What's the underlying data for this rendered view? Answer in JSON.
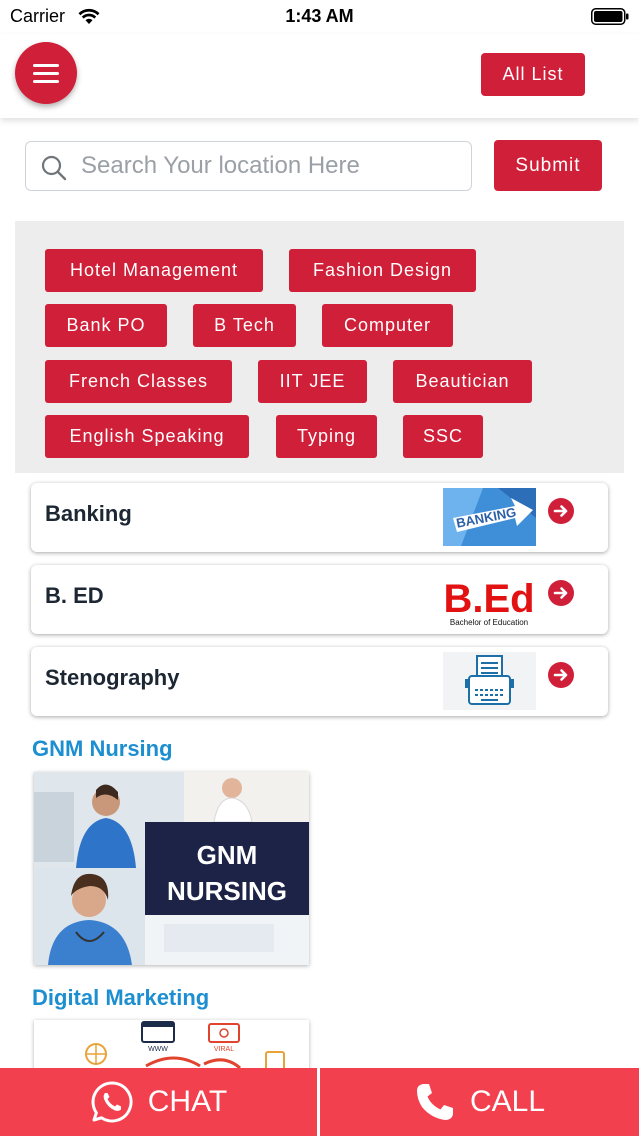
{
  "status_bar": {
    "carrier": "Carrier",
    "time": "1:43 AM"
  },
  "header": {
    "all_list_label": "All List"
  },
  "search": {
    "placeholder": "Search Your location Here",
    "value": "",
    "submit_label": "Submit"
  },
  "tags": [
    "Hotel Management",
    "Fashion Design",
    "Bank PO",
    "B Tech",
    "Computer",
    "French Classes",
    "IIT JEE",
    "Beautician",
    "English Speaking",
    "Typing",
    "SSC"
  ],
  "courses": [
    {
      "title": "Banking",
      "thumb_text": "BANKING"
    },
    {
      "title": "B. ED",
      "thumb_text": "B.Ed",
      "thumb_subtext": "Bachelor of Education"
    },
    {
      "title": "Stenography"
    }
  ],
  "sections": [
    {
      "title": "GNM Nursing",
      "image_text": [
        "GNM",
        "NURSING"
      ]
    },
    {
      "title": "Digital Marketing",
      "image_labels": [
        "WWW",
        "VIRAL"
      ]
    }
  ],
  "bottom_bar": {
    "chat_label": "CHAT",
    "call_label": "CALL"
  },
  "colors": {
    "brand_red": "#d01f38",
    "bottom_bar": "#f3404f",
    "section_title": "#1d8fd0",
    "tag_panel": "#ededed"
  },
  "icons": [
    "menu-icon",
    "search-icon",
    "arrow-right-circle-icon",
    "whatsapp-icon",
    "phone-icon",
    "wifi-icon",
    "battery-icon"
  ]
}
